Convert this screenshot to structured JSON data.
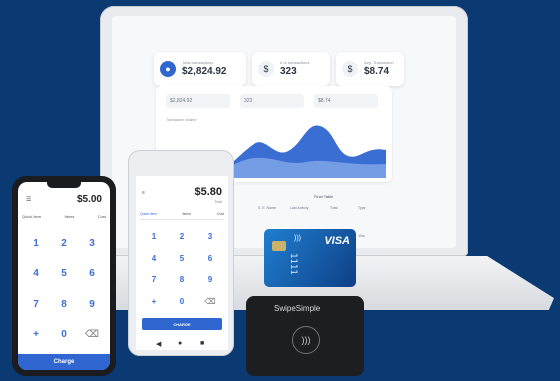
{
  "laptop": {
    "stats": [
      {
        "label": "Total transactions",
        "value": "$2,824.92",
        "icon": "dollar"
      },
      {
        "label": "# of transactions",
        "value": "323",
        "icon": "dollar"
      },
      {
        "label": "Avg. Transaction",
        "value": "$8.74",
        "icon": "dollar"
      }
    ],
    "mini_stats": [
      "$2,824.92",
      "323",
      "$8.74"
    ],
    "chart_title": "Transaction volume",
    "table_title": "Final Table",
    "table_cols": [
      "S. E. Name",
      "Last Activity",
      "Total",
      "Type"
    ],
    "table_val": "Visa"
  },
  "phone": {
    "amount": "$5.00",
    "tabs": [
      "Quick Item",
      "Items",
      "Cust"
    ],
    "keys": [
      "1",
      "2",
      "3",
      "4",
      "5",
      "6",
      "7",
      "8",
      "9",
      "+",
      "0",
      "⌫"
    ],
    "charge_label": "Charge",
    "colors": {
      "accent": "#3b6fd6",
      "button": "#2f66d0"
    }
  },
  "pos": {
    "amount": "$5.80",
    "subtext": "Total",
    "tabs": [
      "Quick Item",
      "Items",
      "Cust"
    ],
    "keys": [
      "1",
      "2",
      "3",
      "4",
      "5",
      "6",
      "7",
      "8",
      "9",
      "+",
      "0",
      "⌫"
    ],
    "charge_label": "CHARGE"
  },
  "card": {
    "brand": "VISA",
    "number_fragment": "1111"
  },
  "reader": {
    "brand": "SwipeSimple"
  }
}
